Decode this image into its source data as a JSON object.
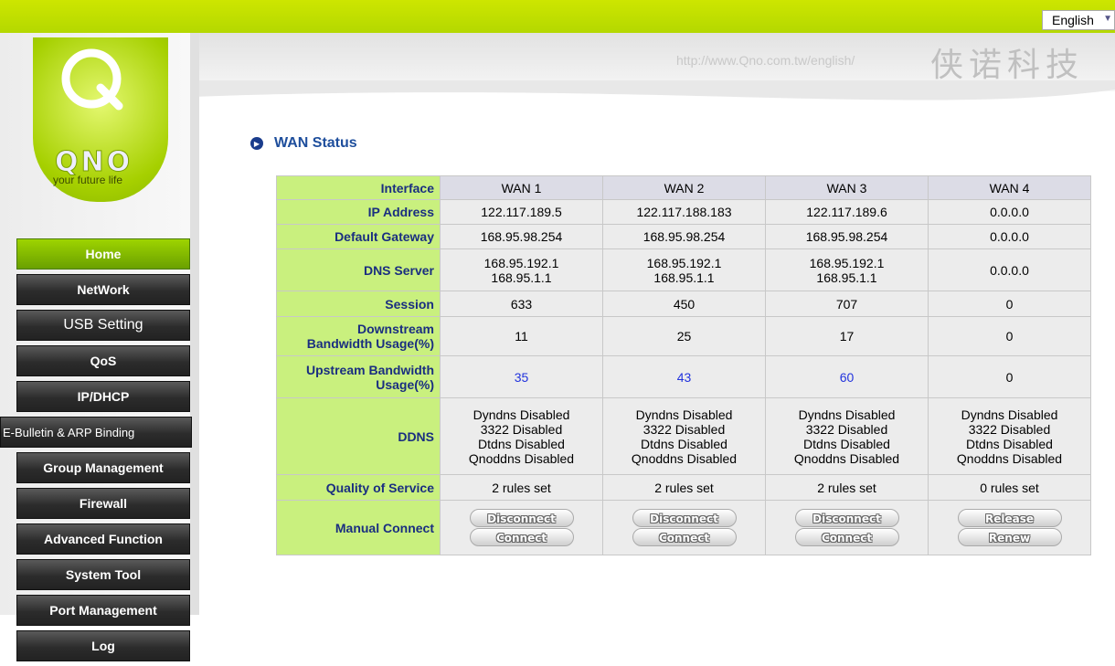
{
  "header": {
    "language": "English",
    "url": "http://www.Qno.com.tw/english/",
    "chinese_brand": "侠诺科技"
  },
  "logo": {
    "brand": "QNO",
    "tagline": "your future life"
  },
  "sidebar": {
    "items": [
      {
        "label": "Home"
      },
      {
        "label": "NetWork"
      },
      {
        "label": "USB Setting"
      },
      {
        "label": "QoS"
      },
      {
        "label": "IP/DHCP"
      },
      {
        "label": "E-Bulletin & ARP  Binding"
      },
      {
        "label": "Group Management"
      },
      {
        "label": "Firewall"
      },
      {
        "label": "Advanced Function"
      },
      {
        "label": "System Tool"
      },
      {
        "label": "Port Management"
      },
      {
        "label": "Log"
      }
    ]
  },
  "page": {
    "title": "WAN Status"
  },
  "wan_table": {
    "interface_label": "Interface",
    "interfaces": [
      "WAN 1",
      "WAN 2",
      "WAN 3",
      "WAN 4"
    ],
    "rows": {
      "ip": {
        "label": "IP Address",
        "values": [
          "122.117.189.5",
          "122.117.188.183",
          "122.117.189.6",
          "0.0.0.0"
        ]
      },
      "gateway": {
        "label": "Default Gateway",
        "values": [
          "168.95.98.254",
          "168.95.98.254",
          "168.95.98.254",
          "0.0.0.0"
        ]
      },
      "dns": {
        "label": "DNS Server",
        "values": [
          [
            "168.95.192.1",
            "168.95.1.1"
          ],
          [
            "168.95.192.1",
            "168.95.1.1"
          ],
          [
            "168.95.192.1",
            "168.95.1.1"
          ],
          [
            "0.0.0.0"
          ]
        ]
      },
      "session": {
        "label": "Session",
        "values": [
          "633",
          "450",
          "707",
          "0"
        ]
      },
      "downstream": {
        "label_1": "Downstream",
        "label_2": "Bandwidth Usage(%)",
        "values": [
          "11",
          "25",
          "17",
          "0"
        ]
      },
      "upstream": {
        "label_1": "Upstream Bandwidth",
        "label_2": "Usage(%)",
        "values": [
          "35",
          "43",
          "60",
          "0"
        ]
      },
      "ddns": {
        "label": "DDNS",
        "values": [
          [
            "Dyndns Disabled",
            "3322 Disabled",
            "Dtdns Disabled",
            "Qnoddns Disabled"
          ],
          [
            "Dyndns Disabled",
            "3322 Disabled",
            "Dtdns Disabled",
            "Qnoddns Disabled"
          ],
          [
            "Dyndns Disabled",
            "3322 Disabled",
            "Dtdns Disabled",
            "Qnoddns Disabled"
          ],
          [
            "Dyndns Disabled",
            "3322 Disabled",
            "Dtdns Disabled",
            "Qnoddns Disabled"
          ]
        ]
      },
      "qos": {
        "label": "Quality of Service",
        "values": [
          "2 rules set",
          "2 rules set",
          "2 rules set",
          "0 rules set"
        ]
      },
      "manual": {
        "label": "Manual Connect",
        "buttons": [
          [
            "Disconnect",
            "Connect"
          ],
          [
            "Disconnect",
            "Connect"
          ],
          [
            "Disconnect",
            "Connect"
          ],
          [
            "Release",
            "Renew"
          ]
        ]
      }
    }
  },
  "colors": {
    "lime": "#b4d800",
    "label_bg": "#c9f07e",
    "label_text": "#1a2e80",
    "upstream_value": "#2233dd",
    "title": "#1e4e9c"
  }
}
